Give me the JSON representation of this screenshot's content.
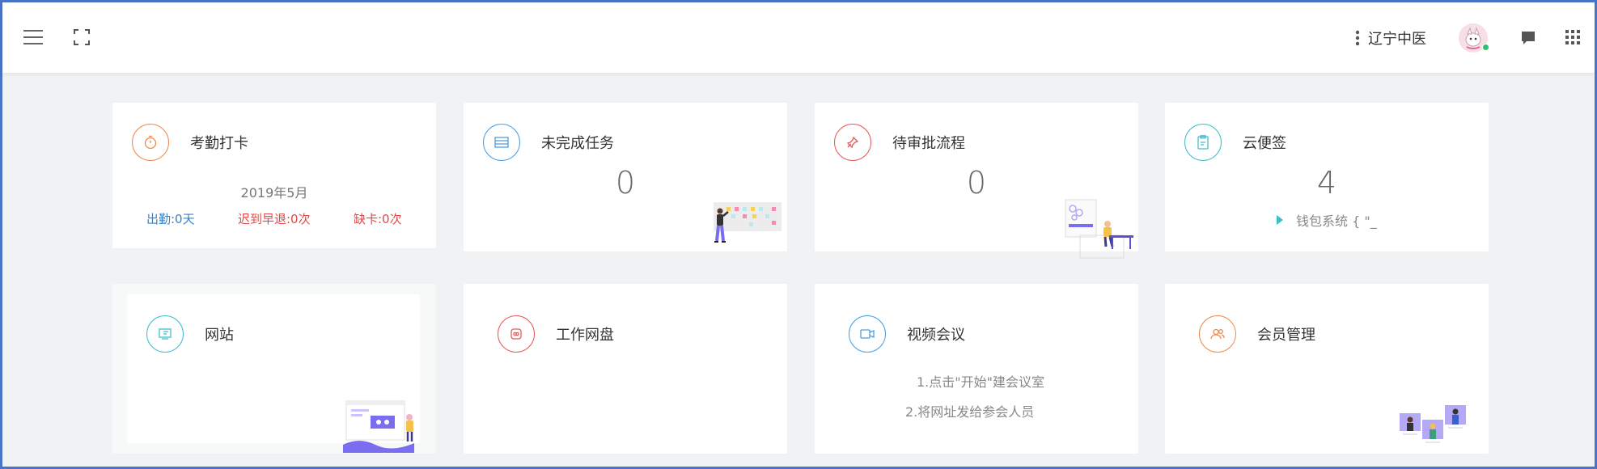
{
  "header": {
    "org_name": "辽宁中医",
    "icons": [
      "menu-icon",
      "fullscreen-icon",
      "more-vertical-icon",
      "chat-icon",
      "apps-grid-icon"
    ]
  },
  "cards": {
    "attendance": {
      "title": "考勤打卡",
      "month": "2019年5月",
      "present": "出勤:0天",
      "late": "迟到早退:0次",
      "missing": "缺卡:0次",
      "accent": "#ee8a4d"
    },
    "tasks": {
      "title": "未完成任务",
      "count": "0",
      "accent": "#4a9ee0"
    },
    "approval": {
      "title": "待审批流程",
      "count": "0",
      "accent": "#e75a56"
    },
    "memo": {
      "title": "云便签",
      "count": "4",
      "latest": "钱包系统 { \"_",
      "accent": "#3fbfcb"
    },
    "website": {
      "title": "网站",
      "accent": "#3fbfcb"
    },
    "netdisk": {
      "title": "工作网盘",
      "accent": "#e75a56"
    },
    "meeting": {
      "title": "视频会议",
      "step1": "1.点击\"开始\"建会议室",
      "step2": "2.将网址发给参会人员",
      "accent": "#4a9ee0"
    },
    "members": {
      "title": "会员管理",
      "accent": "#ee8a4d"
    }
  },
  "colors": {
    "present": "#3a82c9",
    "late": "#e04a4a",
    "missing": "#e04a4a",
    "background": "#f0f2f3",
    "illustration_purple": "#7a6df0"
  }
}
